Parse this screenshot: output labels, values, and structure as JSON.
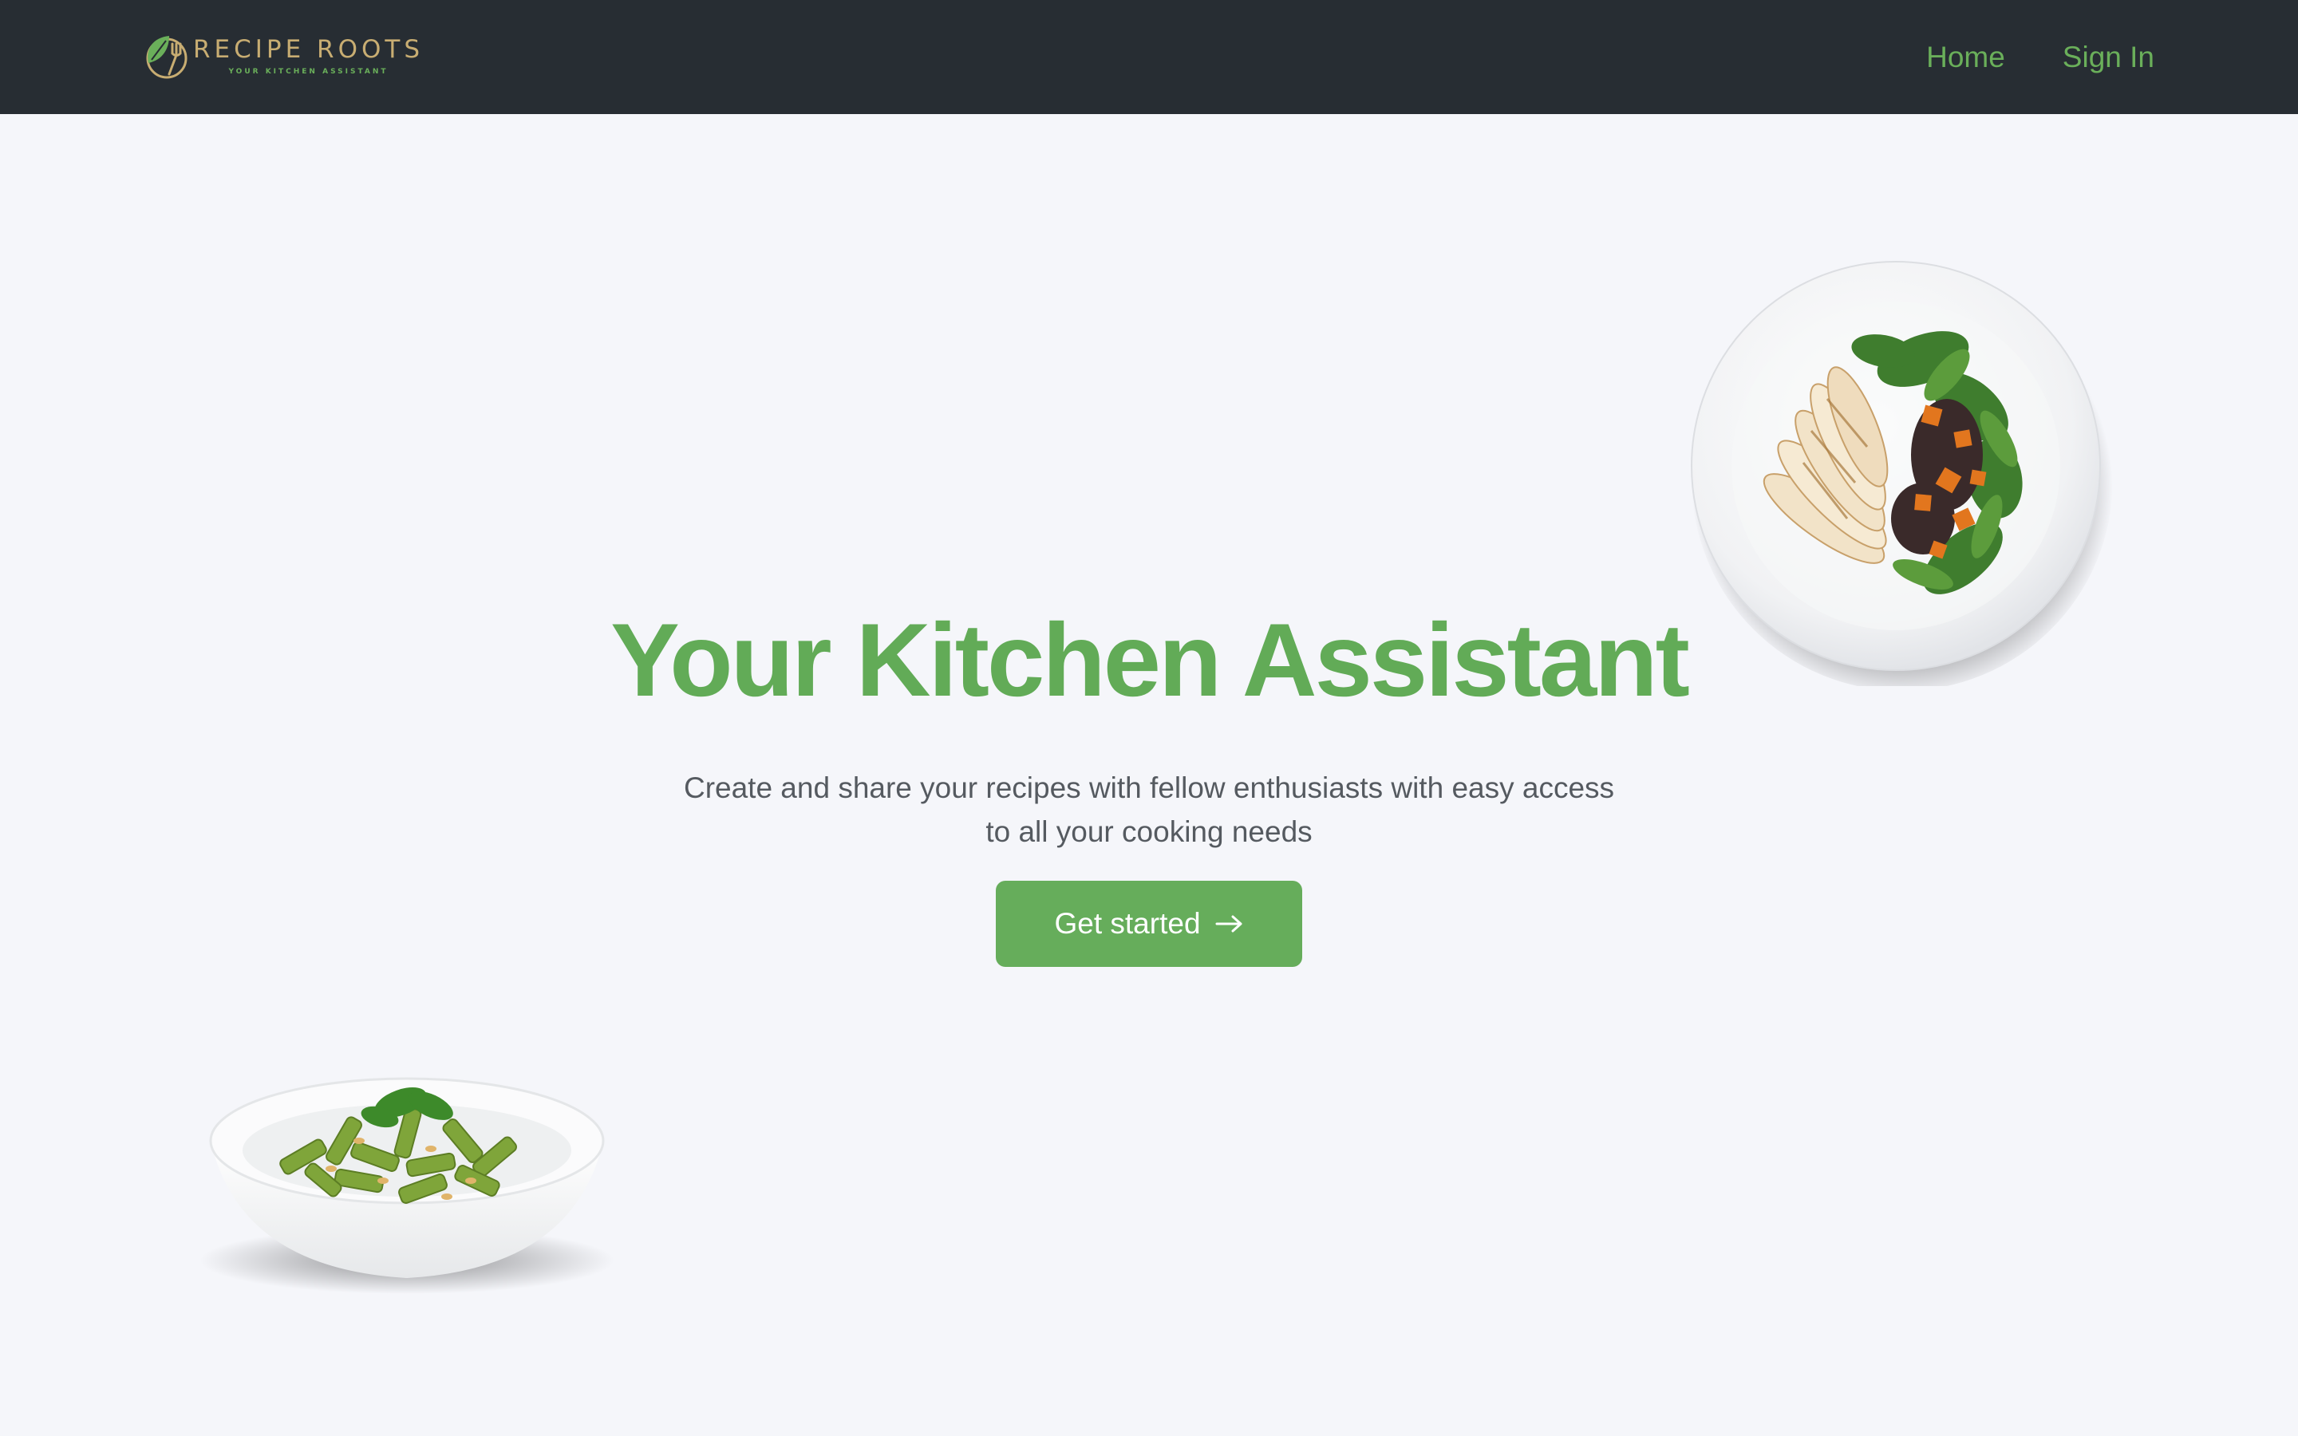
{
  "brand": {
    "name": "RECIPE ROOTS",
    "tagline": "YOUR KITCHEN ASSISTANT",
    "logo_icon": "leaf-fork-icon",
    "colors": {
      "gold": "#c8ad72",
      "green": "#6aaf5a"
    }
  },
  "nav": {
    "home_label": "Home",
    "signin_label": "Sign In"
  },
  "hero": {
    "title": "Your Kitchen Assistant",
    "subtitle": "Create and share your recipes with fellow enthusiasts with easy access to all your cooking needs",
    "cta_label": "Get started",
    "cta_icon": "arrow-right-icon"
  },
  "images": {
    "plate": "grilled-chicken-salad-plate-image",
    "bowl": "pesto-penne-bowl-image"
  },
  "colors": {
    "navbar_bg": "#272d33",
    "page_bg": "#f5f6fa",
    "accent": "#66ad5b",
    "body_text": "#555a60"
  }
}
